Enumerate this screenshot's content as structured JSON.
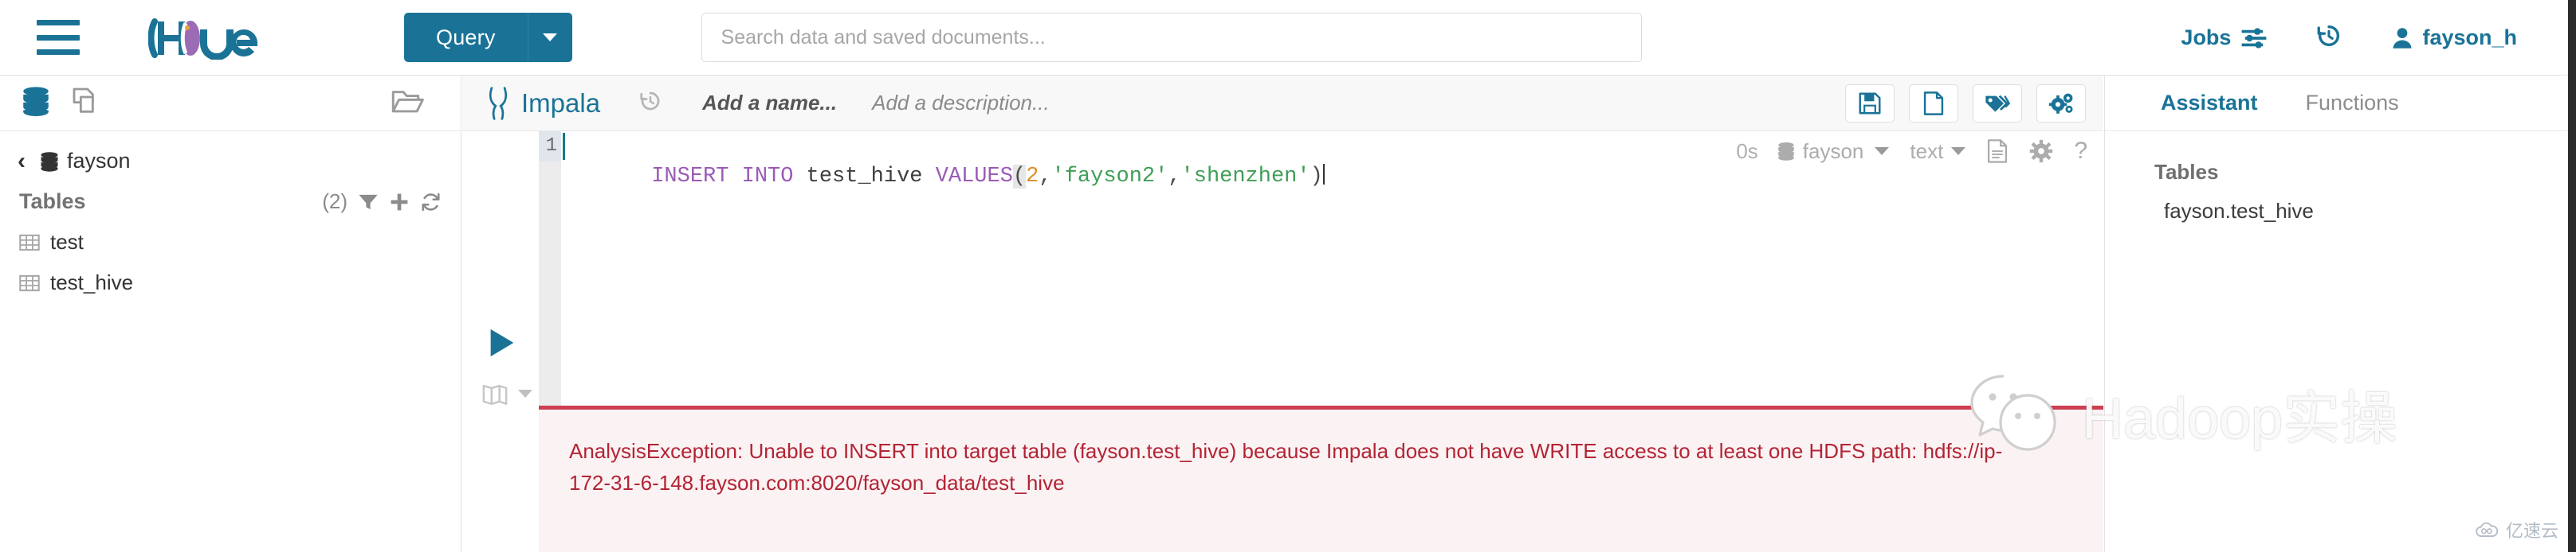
{
  "topbar": {
    "menu_icon": "hamburger-icon",
    "logo_text": "Hue",
    "query_button": "Query",
    "search_placeholder": "Search data and saved documents...",
    "search_value": "",
    "jobs_label": "Jobs",
    "jobs_icon": "sliders-icon",
    "history_icon": "history-icon",
    "user_name": "fayson_h",
    "user_icon": "user-icon",
    "accent_color": "#1a7397"
  },
  "sidebar": {
    "icons": [
      "database-icon",
      "documents-icon",
      "folder-icon"
    ],
    "back_chevron": "‹",
    "database_name": "fayson",
    "tables_label": "Tables",
    "tables_count": "(2)",
    "actions": [
      "filter-icon",
      "plus-icon",
      "refresh-icon"
    ],
    "tables": [
      {
        "name": "test"
      },
      {
        "name": "test_hive"
      }
    ]
  },
  "editor": {
    "engine": "Impala",
    "engine_icon": "impala-icon",
    "history_icon": "history-icon",
    "name_placeholder": "Add a name...",
    "description_placeholder": "Add a description...",
    "toolbar_buttons": [
      {
        "name": "save-icon"
      },
      {
        "name": "new-document-icon"
      },
      {
        "name": "tags-icon"
      },
      {
        "name": "settings-gears-icon"
      }
    ],
    "meta": {
      "duration": "0s",
      "database": "fayson",
      "result_format": "text",
      "doc_icon": "document-icon",
      "gear_icon": "gear-icon",
      "help_icon": "?"
    },
    "run_icon": "play-icon",
    "book_icon": "book-icon",
    "line_number": "1",
    "code": {
      "full": "INSERT INTO test_hive VALUES(2,'fayson2','shenzhen')",
      "tokens": [
        {
          "t": "INSERT INTO ",
          "c": "kw"
        },
        {
          "t": "test_hive ",
          "c": "ident"
        },
        {
          "t": "VALUES",
          "c": "kw"
        },
        {
          "t": "(",
          "c": "paren-hl"
        },
        {
          "t": "2",
          "c": "num"
        },
        {
          "t": ",",
          "c": "punc"
        },
        {
          "t": "'fayson2'",
          "c": "str"
        },
        {
          "t": ",",
          "c": "punc"
        },
        {
          "t": "'shenzhen'",
          "c": "str"
        },
        {
          "t": ")",
          "c": "punc"
        }
      ]
    },
    "error": {
      "message": "AnalysisException: Unable to INSERT into target table (fayson.test_hive) because Impala does not have WRITE access to at least one HDFS path: hdfs://ip-172-31-6-148.fayson.com:8020/fayson_data/test_hive",
      "color": "#b32435",
      "border_color": "#cc3f52",
      "background": "#fbf2f3"
    }
  },
  "assistant": {
    "tab_assistant": "Assistant",
    "tab_functions": "Functions",
    "tables_label": "Tables",
    "table_item": "fayson.test_hive"
  },
  "watermarks": {
    "main_text": "Hadoop实操",
    "main_icon": "wechat-icon",
    "corner_text": "亿速云",
    "corner_icon": "cloud-icon"
  }
}
